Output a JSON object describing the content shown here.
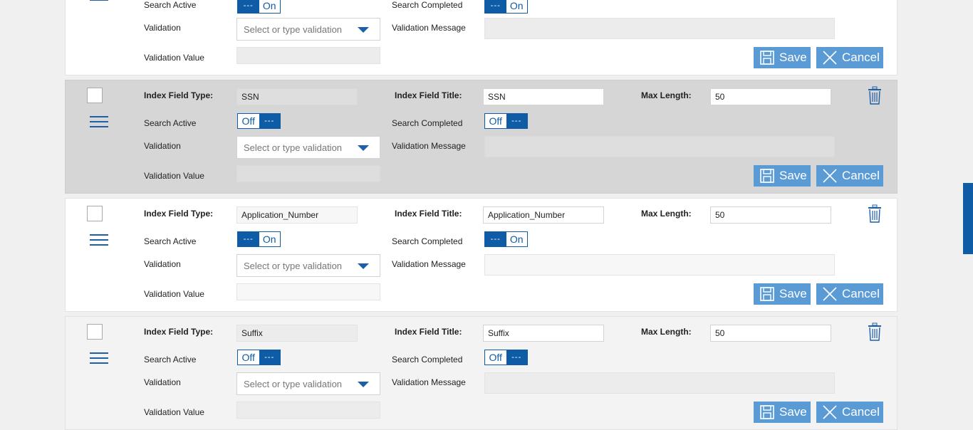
{
  "labels": {
    "index_field_type": "Index Field Type:",
    "index_field_title": "Index Field Title:",
    "max_length": "Max Length:",
    "search_active": "Search Active",
    "search_completed": "Search Completed",
    "validation": "Validation",
    "validation_message": "Validation Message",
    "validation_value": "Validation Value",
    "select_placeholder": "Select or type validation",
    "save": "Save",
    "cancel": "Cancel",
    "on": "On",
    "off": "Off",
    "dots": "---"
  },
  "colors": {
    "accent": "#0f5ca6",
    "button": "#5b9bd5"
  },
  "cards": [
    {
      "field_type": "",
      "field_title": "",
      "max_length": "",
      "search_active": "On",
      "search_completed": "On"
    },
    {
      "field_type": "SSN",
      "field_title": "SSN",
      "max_length": "50",
      "search_active": "Off",
      "search_completed": "Off"
    },
    {
      "field_type": "Application_Number",
      "field_title": "Application_Number",
      "max_length": "50",
      "search_active": "On",
      "search_completed": "On"
    },
    {
      "field_type": "Suffix",
      "field_title": "Suffix",
      "max_length": "50",
      "search_active": "Off",
      "search_completed": "Off"
    }
  ]
}
